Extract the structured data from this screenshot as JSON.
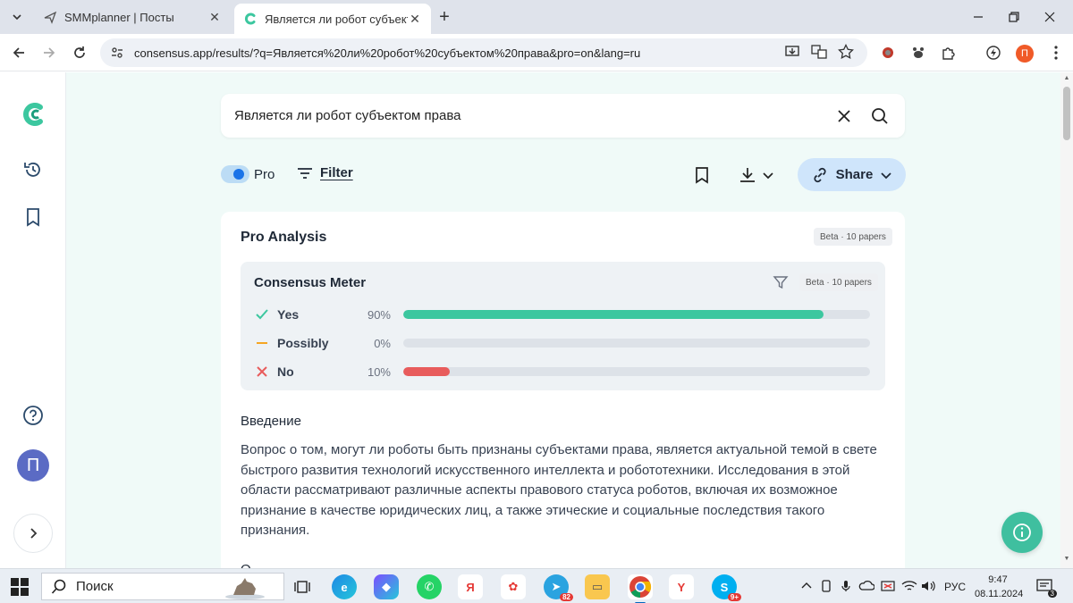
{
  "browser": {
    "tabs": [
      {
        "title": "SMMplanner | Посты"
      },
      {
        "title": "Является ли робот субъектом"
      }
    ],
    "url": "consensus.app/results/?q=Является%20ли%20робот%20субъектом%20права&pro=on&lang=ru",
    "profile_initial": "П"
  },
  "page": {
    "search": {
      "query": "Является ли робот субъектом права"
    },
    "controls": {
      "pro_label": "Pro",
      "filter_label": "Filter",
      "share_label": "Share"
    },
    "analysis": {
      "title": "Pro Analysis",
      "badge": "Beta · 10 papers",
      "meter": {
        "title": "Consensus Meter",
        "badge": "Beta · 10 papers",
        "rows": [
          {
            "label": "Yes",
            "percent_text": "90%",
            "value": 0.9,
            "color": "#3cc79f",
            "icon": "check-icon",
            "icon_color": "#3cc79f"
          },
          {
            "label": "Possibly",
            "percent_text": "0%",
            "value": 0.0,
            "color": "#f5a623",
            "icon": "dash-icon",
            "icon_color": "#f5a623"
          },
          {
            "label": "No",
            "percent_text": "10%",
            "value": 0.1,
            "color": "#e85c5c",
            "icon": "x-icon",
            "icon_color": "#e85c5c"
          }
        ]
      },
      "intro_heading": "Введение",
      "intro_text": "Вопрос о том, могут ли роботы быть признаны субъектами права, является актуальной темой в свете быстрого развития технологий искусственного интеллекта и робототехники. Исследования в этой области рассматривают различные аспекты правового статуса роботов, включая их возможное признание в качестве юридических лиц, а также этические и социальные последствия такого признания.",
      "next_heading": "О"
    },
    "sidebar": {
      "avatar_initial": "П"
    }
  },
  "taskbar": {
    "search_label": "Поиск",
    "telegram_badge": "82",
    "skype_badge": "9+",
    "language": "РУС",
    "time": "9:47",
    "date": "08.11.2024",
    "notifications_badge": "3"
  },
  "colors": {
    "accent": "#3cc79f",
    "share_bg": "#cfe5fb",
    "page_bg": "#f0faf8"
  }
}
